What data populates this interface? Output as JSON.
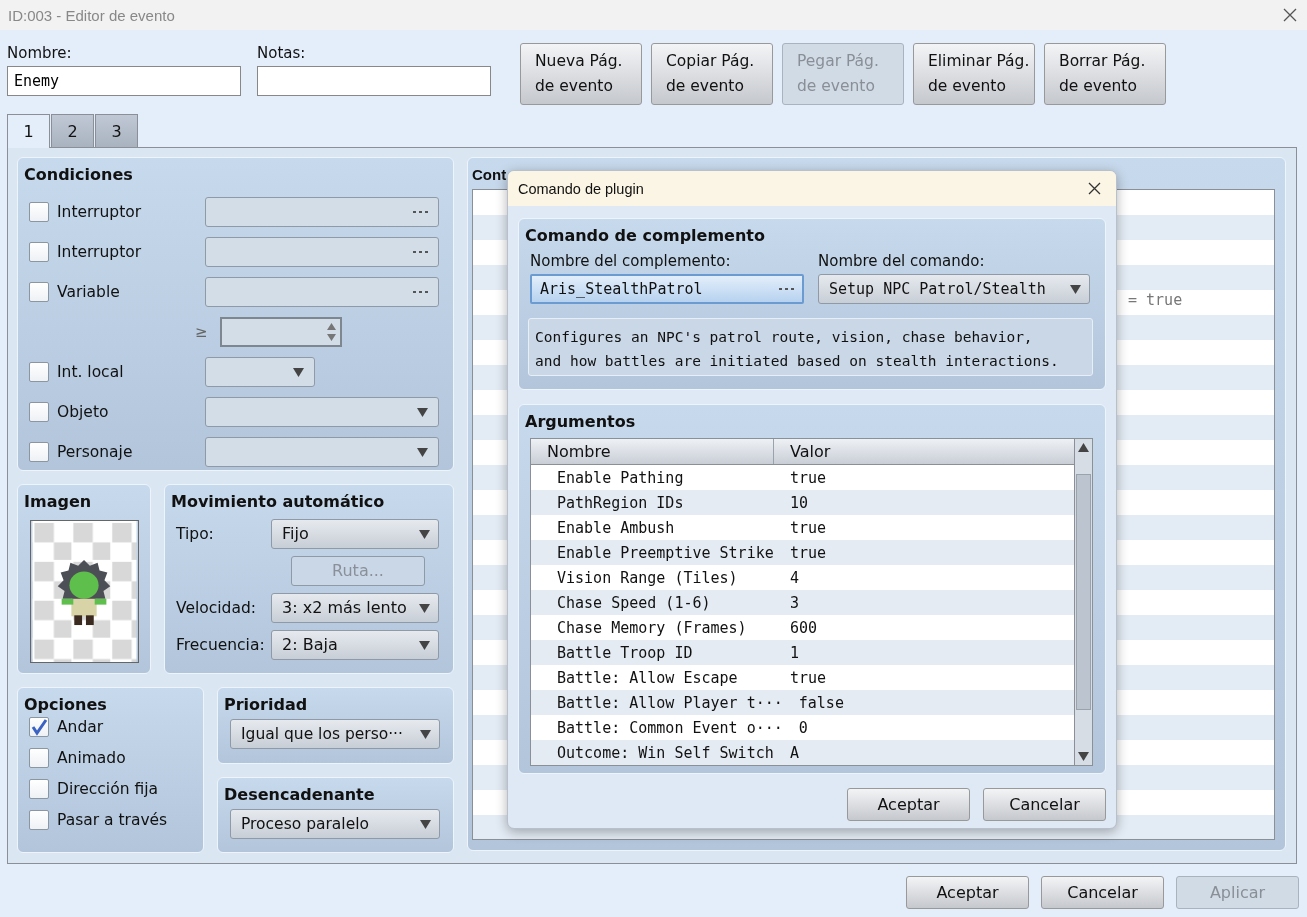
{
  "window": {
    "title": "ID:003 - Editor de evento"
  },
  "name_field": {
    "label": "Nombre:",
    "value": "Enemy"
  },
  "notes_field": {
    "label": "Notas:"
  },
  "page_buttons": [
    {
      "lines": [
        "Nueva Pág.",
        "de evento"
      ],
      "disabled": false
    },
    {
      "lines": [
        "Copiar Pág.",
        "de evento"
      ],
      "disabled": false
    },
    {
      "lines": [
        "Pegar Pág.",
        "de evento"
      ],
      "disabled": true
    },
    {
      "lines": [
        "Eliminar Pág.",
        "de evento"
      ],
      "disabled": false
    },
    {
      "lines": [
        "Borrar Pág.",
        "de evento"
      ],
      "disabled": false
    }
  ],
  "tabs": [
    {
      "label": "1",
      "selected": true
    },
    {
      "label": "2",
      "selected": false
    },
    {
      "label": "3",
      "selected": false
    }
  ],
  "conditions": {
    "title": "Condiciones",
    "rows": [
      {
        "kind": "picker",
        "label": "Interruptor",
        "checked": false
      },
      {
        "kind": "picker",
        "label": "Interruptor",
        "checked": false
      },
      {
        "kind": "picker",
        "label": "Variable",
        "checked": false
      },
      {
        "kind": "compare",
        "symbol": "≥"
      },
      {
        "kind": "small_select",
        "label": "Int. local",
        "checked": false
      },
      {
        "kind": "select",
        "label": "Objeto",
        "checked": false
      },
      {
        "kind": "select",
        "label": "Personaje",
        "checked": false
      }
    ]
  },
  "image": {
    "title": "Imagen"
  },
  "movement": {
    "title": "Movimiento automático",
    "type_label": "Tipo:",
    "type_value": "Fijo",
    "route_button": {
      "label": "Ruta...",
      "disabled": true
    },
    "speed_label": "Velocidad:",
    "speed_value": "3: x2 más lento",
    "frequency_label": "Frecuencia:",
    "frequency_value": "2: Baja"
  },
  "options": {
    "title": "Opciones",
    "items": [
      {
        "label": "Andar",
        "checked": true
      },
      {
        "label": "Animado",
        "checked": false
      },
      {
        "label": "Dirección fija",
        "checked": false
      },
      {
        "label": "Pasar a través",
        "checked": false
      }
    ]
  },
  "priority": {
    "title": "Prioridad",
    "value": "Igual que los perso···"
  },
  "trigger": {
    "title": "Desencadenante",
    "value": "Proceso paralelo"
  },
  "contents": {
    "title": "Cont",
    "visible_text": "= true"
  },
  "dialog": {
    "title": "Comando de plugin",
    "plugin_section": {
      "title": "Comando de complemento",
      "plugin_label": "Nombre del complemento:",
      "plugin_value": "Aris_StealthPatrol",
      "command_label": "Nombre del comando:",
      "command_value": "Setup NPC Patrol/Stealth",
      "description": "Configures an NPC's patrol route, vision, chase behavior,\nand how battles are initiated based on stealth interactions."
    },
    "arguments": {
      "title": "Argumentos",
      "columns": [
        "Nombre",
        "Valor"
      ],
      "rows": [
        {
          "name": "Enable Pathing",
          "value": "true"
        },
        {
          "name": "PathRegion IDs",
          "value": "10"
        },
        {
          "name": "Enable Ambush",
          "value": "true"
        },
        {
          "name": "Enable Preemptive Strike",
          "value": "true"
        },
        {
          "name": "Vision Range (Tiles)",
          "value": "4"
        },
        {
          "name": "Chase Speed (1-6)",
          "value": "3"
        },
        {
          "name": "Chase Memory (Frames)",
          "value": "600"
        },
        {
          "name": "Battle Troop ID",
          "value": "1"
        },
        {
          "name": "Battle: Allow Escape",
          "value": "true"
        },
        {
          "name": "Battle: Allow Player t···",
          "value": "false"
        },
        {
          "name": "Battle: Common Event o···",
          "value": "0"
        },
        {
          "name": "Outcome: Win Self Switch",
          "value": "A"
        }
      ]
    },
    "buttons": [
      {
        "label": "Aceptar",
        "disabled": false
      },
      {
        "label": "Cancelar",
        "disabled": false
      }
    ]
  },
  "footer_buttons": [
    {
      "label": "Aceptar",
      "disabled": false
    },
    {
      "label": "Cancelar",
      "disabled": false
    },
    {
      "label": "Aplicar",
      "disabled": true
    }
  ]
}
